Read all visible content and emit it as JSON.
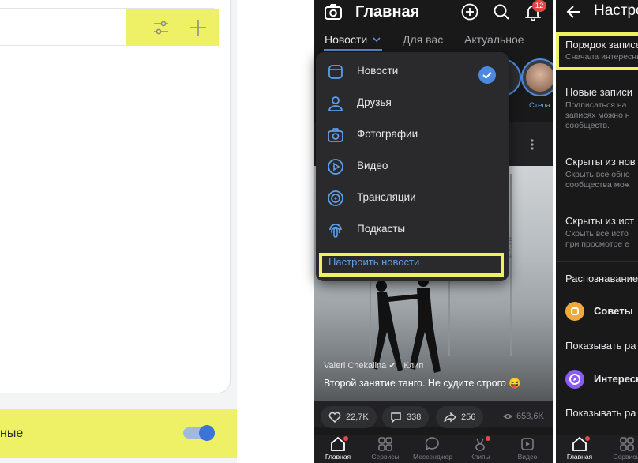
{
  "left_panel": {
    "toggle_row_label": "ные",
    "toggle_on": true,
    "tool_icons": [
      "filter-sliders-icon",
      "plus-icon"
    ],
    "highlight_color": "#eef066"
  },
  "phone_main": {
    "title": "Главная",
    "notification_count": "12",
    "tabs": [
      {
        "label": "Новости",
        "active": true
      },
      {
        "label": "Для вас",
        "active": false
      },
      {
        "label": "Актуальное",
        "active": false
      }
    ],
    "story_name": "Степа",
    "menu": {
      "items": [
        {
          "label": "Новости",
          "icon": "square-icon",
          "checked": true
        },
        {
          "label": "Друзья",
          "icon": "person-icon",
          "checked": false
        },
        {
          "label": "Фотографии",
          "icon": "camera-icon",
          "checked": false
        },
        {
          "label": "Видео",
          "icon": "play-icon",
          "checked": false
        },
        {
          "label": "Трансляции",
          "icon": "broadcast-icon",
          "checked": false
        },
        {
          "label": "Подкасты",
          "icon": "podcast-icon",
          "checked": false
        }
      ],
      "customize_label": "Настроить новости"
    },
    "post": {
      "photo_text": "HIGH LEVEL",
      "author": "Valeri Chekalina",
      "type": "· Клип",
      "caption": "Второй занятие танго. Не судите строго 😝",
      "likes": "22,7K",
      "comments": "338",
      "shares": "256",
      "views": "653,6K"
    },
    "bottom_nav": [
      {
        "label": "Главная",
        "active": true
      },
      {
        "label": "Сервисы",
        "active": false
      },
      {
        "label": "Мессенджер",
        "active": false
      },
      {
        "label": "Клипы",
        "active": false
      },
      {
        "label": "Видео",
        "active": false
      }
    ],
    "accent_color": "#4c8ae1"
  },
  "phone_settings": {
    "title": "Настройки",
    "rows": [
      {
        "title": "Порядок записей",
        "subtitle": "Сначала интересные"
      },
      {
        "title": "Новые записи",
        "subtitle": "Подписаться на\nзаписях можно н\nсообществ."
      },
      {
        "title": "Скрыты из нов",
        "subtitle": "Скрыть все обно\nсообщества мож"
      },
      {
        "title": "Скрыты из ист",
        "subtitle": "Скрыть все исто\nпри просмотре е"
      },
      {
        "title": "Распознавание",
        "subtitle": ""
      },
      {
        "title": "Советы",
        "subtitle": ""
      },
      {
        "title": "Показывать ра",
        "subtitle": ""
      },
      {
        "title": "Интересн",
        "subtitle": ""
      },
      {
        "title": "Показывать ра",
        "subtitle": ""
      }
    ],
    "bottom_nav": [
      {
        "label": "Главная"
      },
      {
        "label": "Сервисы"
      }
    ]
  }
}
